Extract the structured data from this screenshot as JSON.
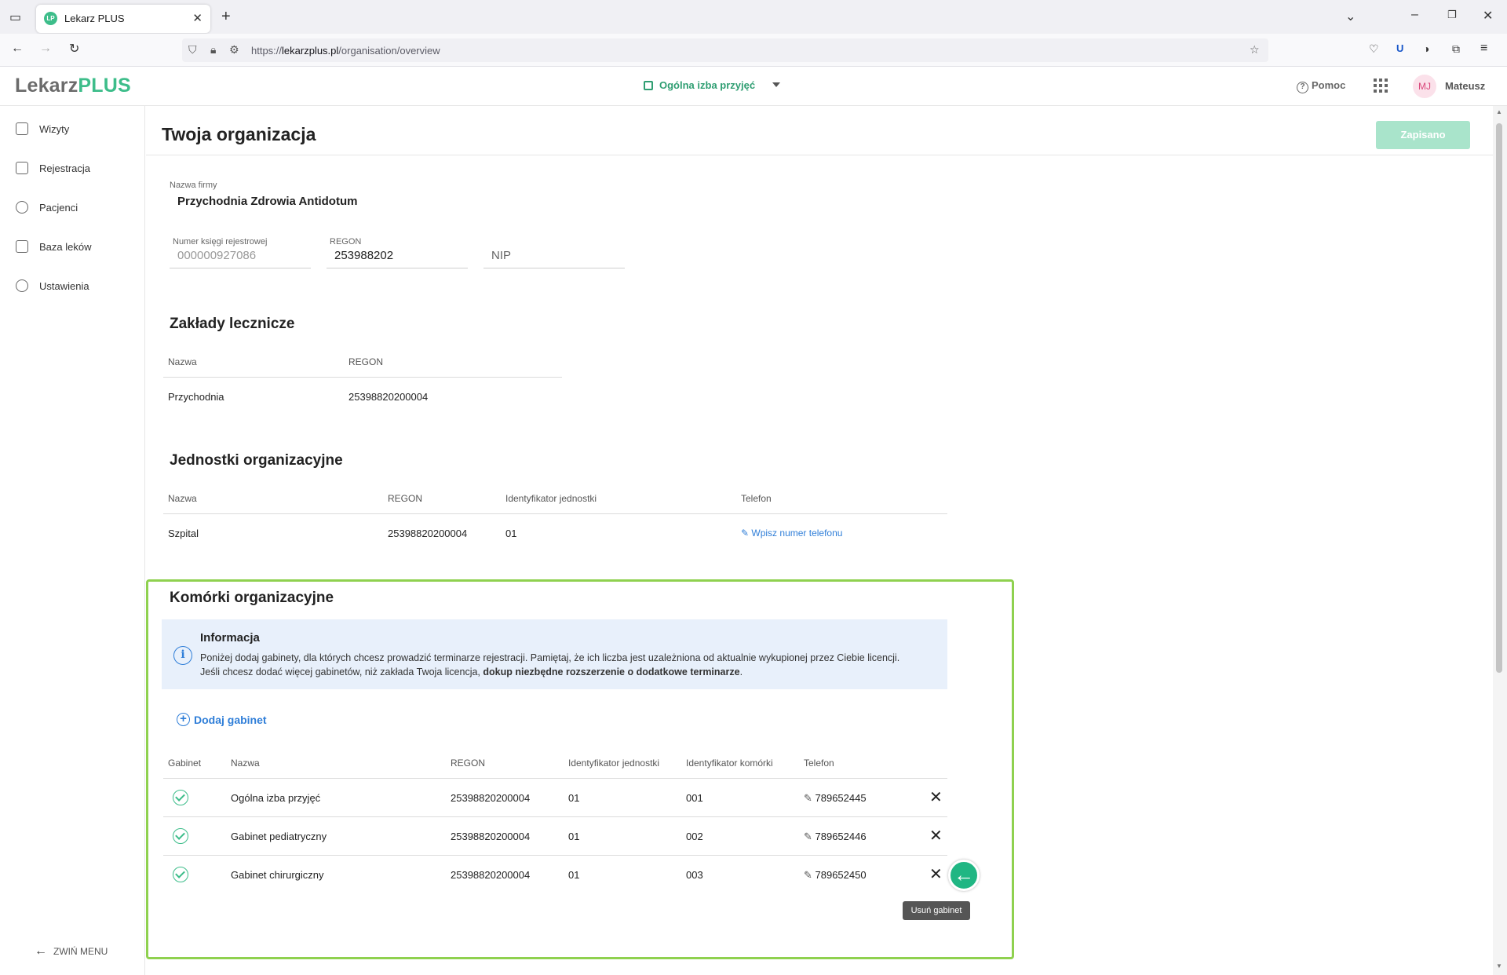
{
  "browser": {
    "tab_title": "Lekarz PLUS",
    "tab_favicon": "LP",
    "url_prefix": "https://",
    "url_domain": "lekarzplus.pl",
    "url_path": "/organisation/overview"
  },
  "app": {
    "logo_a": "Lekarz",
    "logo_b": "PLUS",
    "room_selector": "Ogólna izba przyjęć",
    "help": "Pomoc",
    "avatar_initials": "MJ",
    "user_name": "Mateusz"
  },
  "sidebar": {
    "items": [
      {
        "label": "Wizyty",
        "icon": "visits-icon"
      },
      {
        "label": "Rejestracja",
        "icon": "calendar-icon"
      },
      {
        "label": "Pacjenci",
        "icon": "patients-icon"
      },
      {
        "label": "Baza leków",
        "icon": "medicine-icon"
      },
      {
        "label": "Ustawienia",
        "icon": "gear-icon"
      }
    ],
    "collapse_label": "ZWIŃ MENU"
  },
  "page": {
    "title": "Twoja organizacja",
    "save_label": "Zapisano"
  },
  "company": {
    "name_label": "Nazwa firmy",
    "name_value": "Przychodnia Zdrowia Antidotum",
    "register_label": "Numer księgi rejestrowej",
    "register_value": "000000927086",
    "regon_label": "REGON",
    "regon_value": "253988202",
    "nip_placeholder": "NIP"
  },
  "facilities": {
    "title": "Zakłady lecznicze",
    "headers": [
      "Nazwa",
      "REGON"
    ],
    "rows": [
      {
        "name": "Przychodnia",
        "regon": "25398820200004"
      }
    ]
  },
  "units": {
    "title": "Jednostki organizacyjne",
    "headers": [
      "Nazwa",
      "REGON",
      "Identyfikator jednostki",
      "Telefon"
    ],
    "rows": [
      {
        "name": "Szpital",
        "regon": "25398820200004",
        "unit_id": "01",
        "phone": "Wpisz numer telefonu"
      }
    ]
  },
  "cells": {
    "title": "Komórki organizacyjne",
    "info_title": "Informacja",
    "info_text_1": "Poniżej dodaj gabinety, dla których chcesz prowadzić terminarze rejestracji. Pamiętaj, że ich liczba jest uzależniona od aktualnie wykupionej przez Ciebie licencji.",
    "info_text_2": "Jeśli chcesz dodać więcej gabinetów, niż zakłada Twoja licencja,",
    "info_text_bold": "dokup niezbędne rozszerzenie o dodatkowe terminarze",
    "info_text_end": ".",
    "add_label": "Dodaj gabinet",
    "headers": [
      "Gabinet",
      "Nazwa",
      "REGON",
      "Identyfikator jednostki",
      "Identyfikator komórki",
      "Telefon"
    ],
    "rows": [
      {
        "name": "Ogólna izba przyjęć",
        "regon": "25398820200004",
        "unit_id": "01",
        "cell_id": "001",
        "phone": "789652445"
      },
      {
        "name": "Gabinet pediatryczny",
        "regon": "25398820200004",
        "unit_id": "01",
        "cell_id": "002",
        "phone": "789652446"
      },
      {
        "name": "Gabinet chirurgiczny",
        "regon": "25398820200004",
        "unit_id": "01",
        "cell_id": "003",
        "phone": "789652450"
      }
    ],
    "tooltip": "Usuń gabinet"
  },
  "colors": {
    "brand": "#3dbd8a",
    "link": "#2f7ed8",
    "highlight": "#8fd14f"
  }
}
